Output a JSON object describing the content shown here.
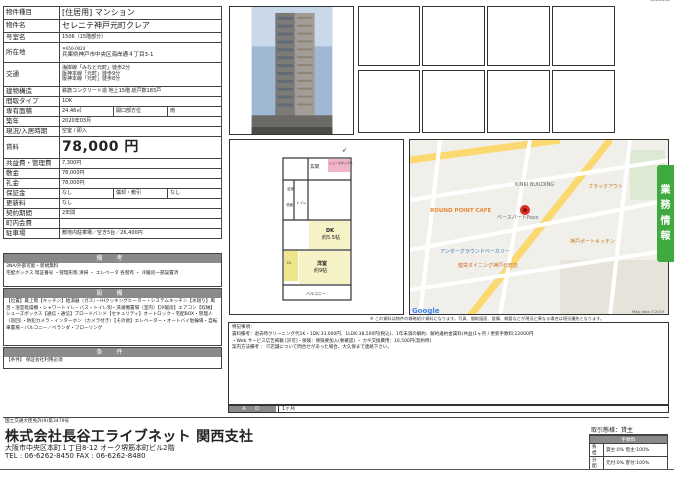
{
  "property": {
    "type_label": "物件種目",
    "type_value": "[住居用] マンション",
    "name_label": "物件名",
    "name_value": "セレニテ神戸元町クレア",
    "room_label": "号室名",
    "room_value": "1506（15階部分）",
    "addr_label": "所在地",
    "addr_zip": "〒650-0024",
    "addr_value": "兵庫県神戸市中央区海岸通４丁目3-1",
    "traffic_label": "交通",
    "traffic_lines": [
      "海岸線「みなと元町」徒歩2分",
      "阪神本線「元町」徒歩9分",
      "阪神本線「元町」徒歩8分"
    ],
    "structure_label": "建物構造",
    "structure_value": "鉄筋コンクリート造 地上15階 総戸数183戸",
    "layout_label": "間取タイプ",
    "layout_value": "1DK",
    "area_label": "専有面積",
    "area_value": "24.46㎡",
    "direction_label": "開口部方位",
    "direction_value": "南",
    "built_label": "築年",
    "built_value": "2020年03月",
    "status_label": "現況/入居時期",
    "status_value": "空室 / 即入",
    "rent_label": "賃料",
    "rent_value": "78,000 円",
    "common_label": "共益費・管理費",
    "common_value": "7,300円",
    "deposit_label": "敷金",
    "deposit_value": "78,000円",
    "key_label": "礼金",
    "key_value": "78,000円",
    "guarantee_label": "保証金",
    "guarantee_value": "なし",
    "amort_label": "償却・敷引",
    "amort_value": "なし",
    "renew_label": "更新料",
    "renew_value": "なし",
    "contract_label": "契約期間",
    "contract_value": "2年間",
    "assoc_label": "町内会費",
    "assoc_value": "",
    "parking_label": "駐車場",
    "parking_value": "敷地内駐車場／空き5台／26,400円"
  },
  "sections": {
    "notes_title": "備 考",
    "notes_text": "3NA/外部可能・新規無料\n宅配ボックス 暗証番号 ・管理形態 清掃 ・ エレベータ 各階有 ・ 冷暖房一部設置済",
    "facilities_title": "設 備",
    "facilities_text": "【位置】最上階【キッチン】給湯器（ガス）・IHクッキングヒーター・システムキッチン【水廻り】風呂・浴室乾燥機・シャワートイレ・バス・トイレ別・洗濯機置場（室内）【冷暖房】エアコン【収納】シューズボックス【通信・通信】ブロードバンド【セキュリティ】オートロック・宅配BOX・管理人（巡回）・防犯カメラ・インターホン（カメラ付き）【その他】エレベーター・オートバイ駐輪場・自転車置場・バルコニー／ベランダ・フローリング",
    "conditions_title": "条 件",
    "conditions_text": "【条件】 保証会社利用必須"
  },
  "floorplan": {
    "dk_label": "DK",
    "dk_size": "約5.5帖",
    "room_label": "洋室",
    "room_size": "約9帖",
    "entrance_label": "玄関",
    "closet_label": "シューズボックス",
    "bath_label": "浴室",
    "wash_label": "洗面",
    "toilet_label": "トイレ",
    "cl_label": "CL",
    "balcony_label": "バルコニー"
  },
  "map": {
    "labels": [
      "KINKI BUILDING",
      "ブラックアウト",
      "ROUND POINT CAFE",
      "アンダーグラウンドベーカリー",
      "健栄ダイニング神戸元町店",
      "神戸ポートキッチン",
      "ベースパートPoco"
    ],
    "google_label": "Google",
    "attribution": "Map data ©2019"
  },
  "notice": "※ この資料は物件の概略紹介資料になります。写真、間取図面、設備、概要などが現況と異なる場合は現況優先となります。",
  "remarks": {
    "text": "特記事項：\n賃料備考：退去時クリーニング代1K・1DK:33,000円、1LDK:38,500円(税込)、1年未満の解約、解約違約金賃料(共益)1ヶ月 / 更新手数料:22000円\n・Web サービス広告掲載 [許可]・保険：保険要加入(要確認) ・ カギ交換費用：16,500円(契約時)\n案内方法備考 ： IT店舗について問合せがあった場合、大久保まで連絡下さい。"
  },
  "ad": {
    "label": "A D",
    "value": "1ヶ月"
  },
  "company": {
    "license": "国土交通大臣免許(9)第3479号",
    "name": "株式会社長谷工ライブネット 関西支社",
    "address": "大阪市中央区本町１丁目8-12 オーク堺筋本町ビル2階",
    "tel": "TEL : 06-6262-8450   FAX : 06-6262-8480"
  },
  "deal": {
    "title": "取引態様：貸主",
    "fee_head": "手数料",
    "row1_label": "負担",
    "row1_value": "貸主:0% 借主:100%",
    "row2_label": "分配",
    "row2_value": "元付:0% 客付:100%"
  },
  "side_tab": {
    "chars": [
      "業",
      "務",
      "情",
      "報"
    ]
  },
  "colors": {
    "header_gray": "#8a8a8a",
    "side_tab_green": "#3faa3f",
    "map_pin_red": "#d93025"
  }
}
